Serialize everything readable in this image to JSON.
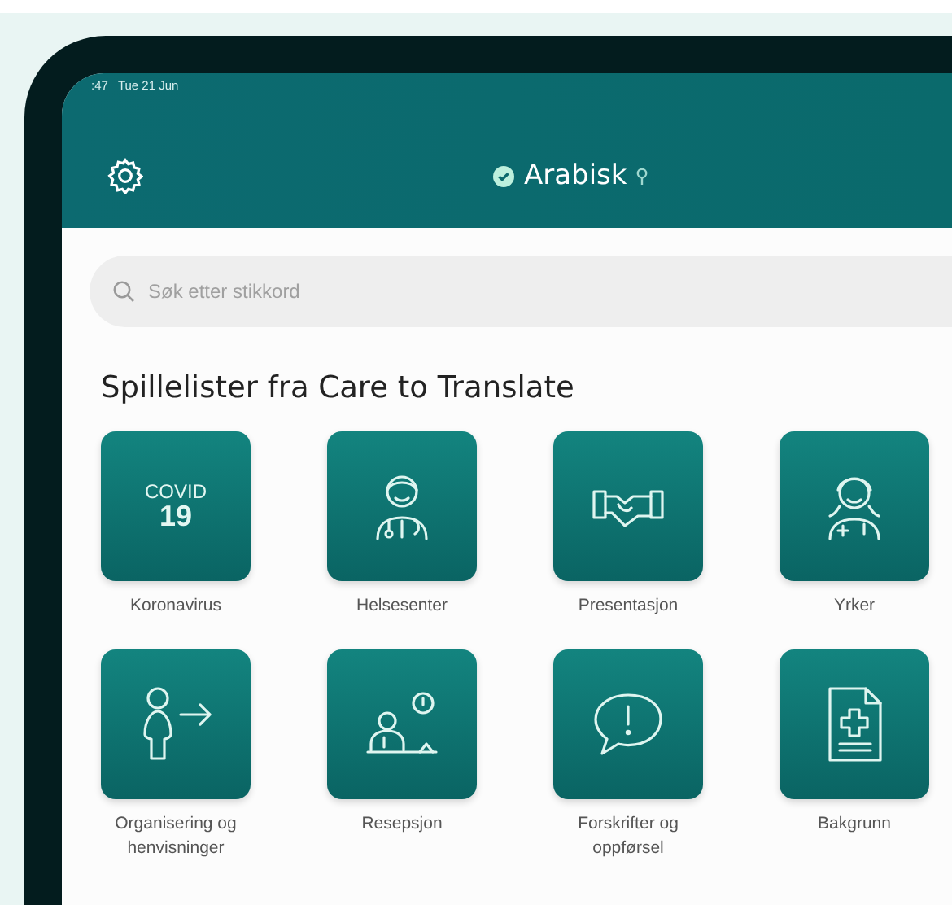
{
  "status_bar": {
    "time": ":47",
    "date": "Tue 21 Jun"
  },
  "header": {
    "language": "Arabisk"
  },
  "search": {
    "placeholder": "Søk etter stikkord"
  },
  "section": {
    "title": "Spillelister fra Care to Translate"
  },
  "tiles": [
    {
      "label": "Koronavirus",
      "tile_text": [
        "COVID",
        "19"
      ]
    },
    {
      "label": "Helsesenter"
    },
    {
      "label": "Presentasjon"
    },
    {
      "label": "Yrker"
    },
    {
      "label": "Organisering og henvisninger"
    },
    {
      "label": "Resepsjon"
    },
    {
      "label": "Forskrifter og oppførsel"
    },
    {
      "label": "Bakgrunn"
    }
  ]
}
